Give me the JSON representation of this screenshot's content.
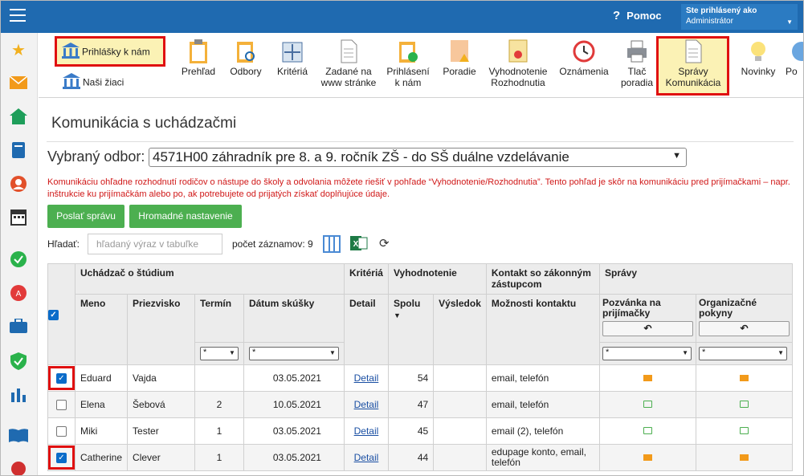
{
  "header": {
    "help_label": "Pomoc",
    "user_line1": "Ste prihlásený ako",
    "user_line2": "Administrátor"
  },
  "toolbar": {
    "left": [
      {
        "label": "Prihlášky k nám"
      },
      {
        "label": "Naši žiaci"
      }
    ],
    "items": [
      {
        "label": "Prehľad"
      },
      {
        "label": "Odbory"
      },
      {
        "label": "Kritériá"
      },
      {
        "label": "Zadané na\nwww stránke"
      },
      {
        "label": "Prihlásení\nk nám"
      },
      {
        "label": "Poradie"
      },
      {
        "label": "Vyhodnotenie\nRozhodnutia"
      },
      {
        "label": "Oznámenia"
      },
      {
        "label": "Tlač\nporadia"
      },
      {
        "label": "Správy\nKomunikácia"
      },
      {
        "label": "Novinky"
      },
      {
        "label": "Po"
      }
    ]
  },
  "page": {
    "title": "Komunikácia s uchádzačmi",
    "odbor_label": "Vybraný odbor:",
    "odbor_value": "4571H00 záhradník pre 8. a 9. ročník ZŠ - do SŠ duálne vzdelávanie",
    "warning": "Komunikáciu ohľadne rozhodnutí rodičov o nástupe do školy a odvolania môžete riešiť v pohľade “Vyhodnotenie/Rozhodnutia”. Tento pohľad je skôr na komunikáciu pred prijímačkami – napr. inštrukcie ku prijímačkám alebo po, ak potrebujete od prijatých získať doplňujúce údaje.",
    "btn_send": "Poslať správu",
    "btn_bulk": "Hromadné nastavenie",
    "search_label": "Hľadať:",
    "search_placeholder": "hľadaný výraz v tabuľke",
    "count_text": "počet záznamov: 9"
  },
  "table": {
    "groups": {
      "applicant": "Uchádzač o štúdium",
      "criteria": "Kritériá",
      "eval": "Vyhodnotenie",
      "contact": "Kontakt so zákonným zástupcom",
      "messages": "Správy"
    },
    "cols": {
      "meno": "Meno",
      "priezvisko": "Priezvisko",
      "termin": "Termín",
      "datum": "Dátum skúšky",
      "detail": "Detail",
      "spolu": "Spolu",
      "vysledok": "Výsledok",
      "moznosti": "Možnosti kontaktu",
      "pozvanka": "Pozvánka na prijímačky",
      "org": "Organizačné pokyny"
    },
    "filter_all": "*",
    "rows": [
      {
        "checked": true,
        "meno": "Eduard",
        "priezvisko": "Vajda",
        "termin": "",
        "datum": "03.05.2021",
        "detail": "Detail",
        "spolu": "54",
        "vysledok": "",
        "kontakt": "email, telefón",
        "poz": "sent",
        "org": "sent"
      },
      {
        "checked": false,
        "meno": "Elena",
        "priezvisko": "Šebová",
        "termin": "2",
        "datum": "10.05.2021",
        "detail": "Detail",
        "spolu": "47",
        "vysledok": "",
        "kontakt": "email, telefón",
        "poz": "read",
        "org": "read"
      },
      {
        "checked": false,
        "meno": "Miki",
        "priezvisko": "Tester",
        "termin": "1",
        "datum": "03.05.2021",
        "detail": "Detail",
        "spolu": "45",
        "vysledok": "",
        "kontakt": "email (2), telefón",
        "poz": "read",
        "org": "read"
      },
      {
        "checked": true,
        "meno": "Catherine",
        "priezvisko": "Clever",
        "termin": "1",
        "datum": "03.05.2021",
        "detail": "Detail",
        "spolu": "44",
        "vysledok": "",
        "kontakt": "edupage konto, email, telefón",
        "poz": "sent",
        "org": "sent"
      }
    ]
  }
}
